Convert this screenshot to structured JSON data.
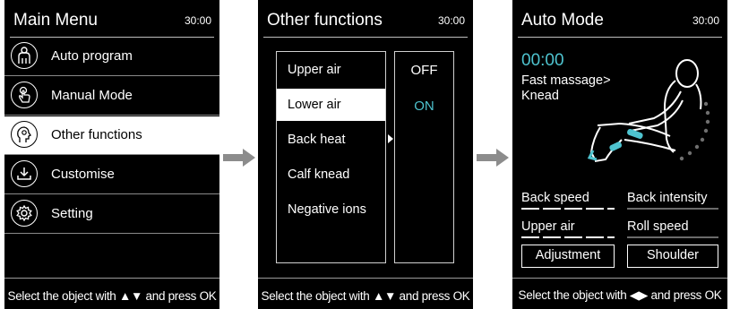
{
  "screen1": {
    "title": "Main Menu",
    "clock": "30:00",
    "items": [
      {
        "label": "Auto program",
        "icon": "body-silhouette-icon"
      },
      {
        "label": "Manual Mode",
        "icon": "hand-touch-icon"
      },
      {
        "label": "Other functions",
        "icon": "head-profile-icon",
        "selected": true
      },
      {
        "label": "Customise",
        "icon": "download-tray-icon"
      },
      {
        "label": "Setting",
        "icon": "gear-icon"
      }
    ],
    "hint_prefix": "Select the object with ",
    "hint_symbol": "▲▼",
    "hint_suffix": " and press OK"
  },
  "screen2": {
    "title": "Other functions",
    "clock": "30:00",
    "options": [
      "Upper air",
      "Lower air",
      "Back heat",
      "Calf knead",
      "Negative ions"
    ],
    "selected_option": "Lower air",
    "values": [
      "OFF",
      "ON"
    ],
    "hint_prefix": "Select the object with ",
    "hint_symbol": "▲▼",
    "hint_suffix": " and press OK"
  },
  "screen3": {
    "title": "Auto Mode",
    "clock": "30:00",
    "timer": "00:00",
    "program_line1": "Fast massage>",
    "program_line2": "Knead",
    "params": {
      "back_speed": "Back speed",
      "back_intensity": "Back intensity",
      "upper_air": "Upper air",
      "roll_speed": "Roll speed"
    },
    "buttons": {
      "adjustment": "Adjustment",
      "shoulder": "Shoulder"
    },
    "hint_prefix": "Select the object with ",
    "hint_symbol": "◀▶",
    "hint_suffix": " and press OK"
  },
  "colors": {
    "accent": "#4ec3cf",
    "screen_bg": "#000000",
    "arrow": "#8c8c8c"
  }
}
